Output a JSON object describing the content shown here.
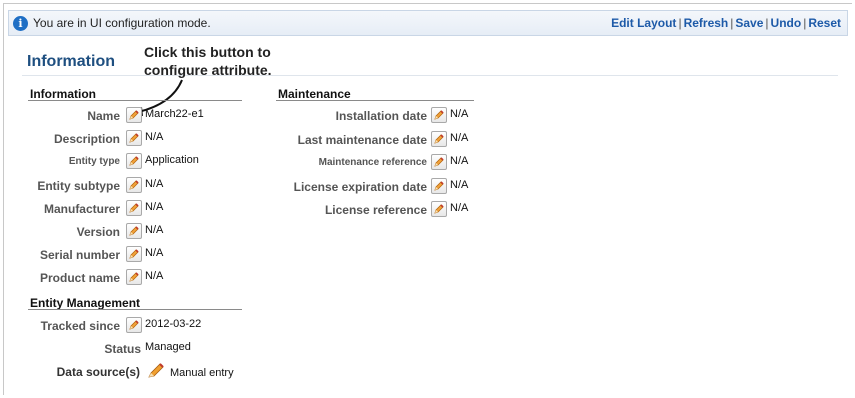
{
  "topbar": {
    "mode_text": "You are in UI configuration mode.",
    "actions": [
      "Edit Layout",
      "Refresh",
      "Save",
      "Undo",
      "Reset"
    ]
  },
  "panel": {
    "title": "Information"
  },
  "callout": {
    "line1": "Click this button to",
    "line2": "configure attribute."
  },
  "information": {
    "heading": "Information",
    "rows": [
      {
        "label": "Name",
        "value": "March22-e1"
      },
      {
        "label": "Description",
        "value": "N/A"
      },
      {
        "label": "Entity type",
        "value": "Application"
      },
      {
        "label": "Entity subtype",
        "value": "N/A"
      },
      {
        "label": "Manufacturer",
        "value": "N/A"
      },
      {
        "label": "Version",
        "value": "N/A"
      },
      {
        "label": "Serial number",
        "value": "N/A"
      },
      {
        "label": "Product name",
        "value": "N/A"
      }
    ]
  },
  "entity_management": {
    "heading": "Entity Management",
    "rows": [
      {
        "label": "Tracked since",
        "value": "2012-03-22"
      },
      {
        "label": "Status",
        "value": "Managed"
      },
      {
        "label": "Data source(s)",
        "value": "Manual entry"
      }
    ]
  },
  "maintenance": {
    "heading": "Maintenance",
    "rows": [
      {
        "label": "Installation date",
        "value": "N/A"
      },
      {
        "label": "Last maintenance date",
        "value": "N/A"
      },
      {
        "label": "Maintenance reference",
        "value": "N/A"
      },
      {
        "label": "License expiration date",
        "value": "N/A"
      },
      {
        "label": "License reference",
        "value": "N/A"
      }
    ]
  },
  "icons": {
    "info": "info-icon",
    "edit": "edit-icon",
    "data_source": "pencil-icon"
  },
  "colors": {
    "link": "#1d5aa8",
    "title": "#1e4f80",
    "info_icon": "#1f6fc5"
  }
}
